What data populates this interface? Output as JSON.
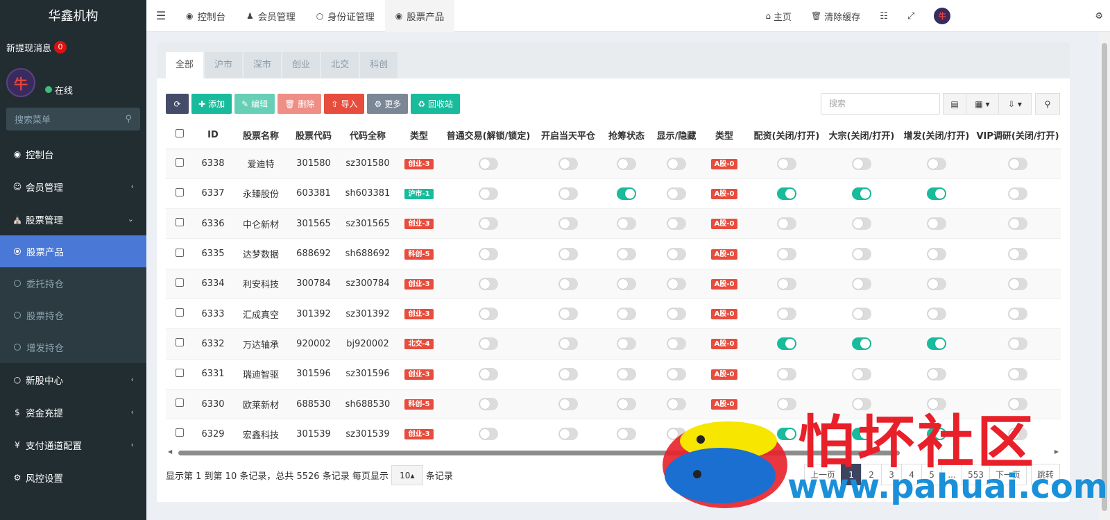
{
  "sidebar": {
    "brand": "华鑫机构",
    "withdraw_label": "新提现消息",
    "withdraw_count": "0",
    "avatar_glyph": "牛",
    "online_label": "在线",
    "search_placeholder": "搜索菜单",
    "menu": [
      {
        "label": "控制台",
        "icon": "dashboard-icon"
      },
      {
        "label": "会员管理",
        "icon": "user-circle-icon"
      },
      {
        "label": "股票管理",
        "icon": "bank-icon"
      },
      {
        "label": "新股中心",
        "icon": "circle-icon"
      },
      {
        "label": "资金充提",
        "icon": "dollar-icon"
      },
      {
        "label": "支付通道配置",
        "icon": "yen-icon"
      },
      {
        "label": "风控设置",
        "icon": "gear-icon"
      }
    ],
    "submenu": [
      {
        "label": "股票产品"
      },
      {
        "label": "委托持仓"
      },
      {
        "label": "股票持仓"
      },
      {
        "label": "增发持仓"
      }
    ]
  },
  "topnav": {
    "tabs": [
      {
        "label": "控制台",
        "icon": "dashboard-icon"
      },
      {
        "label": "会员管理",
        "icon": "user-icon"
      },
      {
        "label": "身份证管理",
        "icon": "circle-icon"
      },
      {
        "label": "股票产品",
        "icon": "dot-circle-icon"
      }
    ],
    "home_label": "主页",
    "clear_cache_label": "清除缓存"
  },
  "subtabs": [
    "全部",
    "沪市",
    "深市",
    "创业",
    "北交",
    "科创"
  ],
  "toolbar": {
    "add": "添加",
    "edit": "编辑",
    "delete": "删除",
    "import": "导入",
    "more": "更多",
    "recycle": "回收站",
    "search_placeholder": "搜索"
  },
  "table": {
    "headers": [
      "ID",
      "股票名称",
      "股票代码",
      "代码全称",
      "类型",
      "普通交易(解锁/锁定)",
      "开启当天平仓",
      "抢筹状态",
      "显示/隐藏",
      "类型",
      "配资(关闭/打开)",
      "大宗(关闭/打开)",
      "增发(关闭/打开)",
      "VIP调研(关闭/打开)"
    ],
    "rows": [
      {
        "id": "6338",
        "name": "爱迪特",
        "code": "301580",
        "full": "sz301580",
        "type": "创业-3",
        "type_color": "red",
        "atype": "A股-0",
        "t": [
          0,
          0,
          0,
          0,
          0,
          0,
          0,
          0
        ]
      },
      {
        "id": "6337",
        "name": "永臻股份",
        "code": "603381",
        "full": "sh603381",
        "type": "沪市-1",
        "type_color": "green",
        "atype": "A股-0",
        "t": [
          0,
          0,
          1,
          0,
          1,
          1,
          1,
          0
        ]
      },
      {
        "id": "6336",
        "name": "中仑新材",
        "code": "301565",
        "full": "sz301565",
        "type": "创业-3",
        "type_color": "red",
        "atype": "A股-0",
        "t": [
          0,
          0,
          0,
          0,
          0,
          0,
          0,
          0
        ]
      },
      {
        "id": "6335",
        "name": "达梦数据",
        "code": "688692",
        "full": "sh688692",
        "type": "科创-5",
        "type_color": "red",
        "atype": "A股-0",
        "t": [
          0,
          0,
          0,
          0,
          0,
          0,
          0,
          0
        ]
      },
      {
        "id": "6334",
        "name": "利安科技",
        "code": "300784",
        "full": "sz300784",
        "type": "创业-3",
        "type_color": "red",
        "atype": "A股-0",
        "t": [
          0,
          0,
          0,
          0,
          0,
          0,
          0,
          0
        ]
      },
      {
        "id": "6333",
        "name": "汇成真空",
        "code": "301392",
        "full": "sz301392",
        "type": "创业-3",
        "type_color": "red",
        "atype": "A股-0",
        "t": [
          0,
          0,
          0,
          0,
          0,
          0,
          0,
          0
        ]
      },
      {
        "id": "6332",
        "name": "万达轴承",
        "code": "920002",
        "full": "bj920002",
        "type": "北交-4",
        "type_color": "red",
        "atype": "A股-0",
        "t": [
          0,
          0,
          0,
          0,
          1,
          1,
          1,
          0
        ]
      },
      {
        "id": "6331",
        "name": "瑞迪智驱",
        "code": "301596",
        "full": "sz301596",
        "type": "创业-3",
        "type_color": "red",
        "atype": "A股-0",
        "t": [
          0,
          0,
          0,
          0,
          0,
          0,
          0,
          0
        ]
      },
      {
        "id": "6330",
        "name": "欧莱新材",
        "code": "688530",
        "full": "sh688530",
        "type": "科创-5",
        "type_color": "red",
        "atype": "A股-0",
        "t": [
          0,
          0,
          0,
          0,
          0,
          0,
          0,
          0
        ]
      },
      {
        "id": "6329",
        "name": "宏鑫科技",
        "code": "301539",
        "full": "sz301539",
        "type": "创业-3",
        "type_color": "red",
        "atype": "A股-0",
        "t": [
          0,
          0,
          0,
          0,
          1,
          1,
          1,
          0
        ]
      }
    ]
  },
  "footer": {
    "info_prefix": "显示第 1 到第 10 条记录，总共 5526 条记录 每页显示",
    "page_size": "10",
    "info_suffix": "条记录"
  },
  "pager": {
    "prev": "上一页",
    "pages": [
      "1",
      "2",
      "3",
      "4",
      "5"
    ],
    "ellipsis": "...",
    "last": "553",
    "next": "下一页",
    "jump": "跳转"
  },
  "watermark": {
    "cn": "怕坏社区",
    "url": "www.pahuai.com"
  },
  "colors": {
    "sidebar_bg": "#222d32",
    "active_blue": "#4a78d6",
    "toggle_on": "#18bc9c",
    "label_red": "#e74c3c"
  }
}
